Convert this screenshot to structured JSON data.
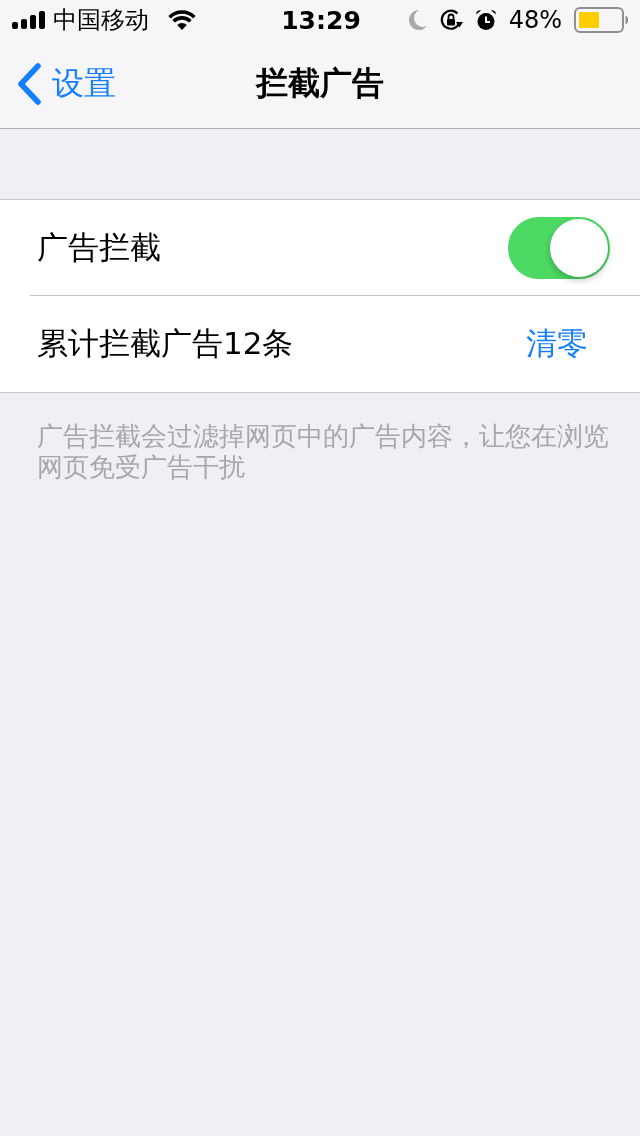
{
  "status_bar": {
    "carrier": "中国移动",
    "time": "13:29",
    "battery_percent": "48%"
  },
  "nav_bar": {
    "back_label": "设置",
    "title": "拦截广告"
  },
  "settings_group": {
    "rows": [
      {
        "kind": "toggle",
        "label": "广告拦截",
        "on": true
      },
      {
        "kind": "action",
        "label": "累计拦截广告12条",
        "action": "清零"
      }
    ]
  },
  "footer": "广告拦截会过滤掉网页中的广告内容，让您在浏览网页免受广告干扰"
}
